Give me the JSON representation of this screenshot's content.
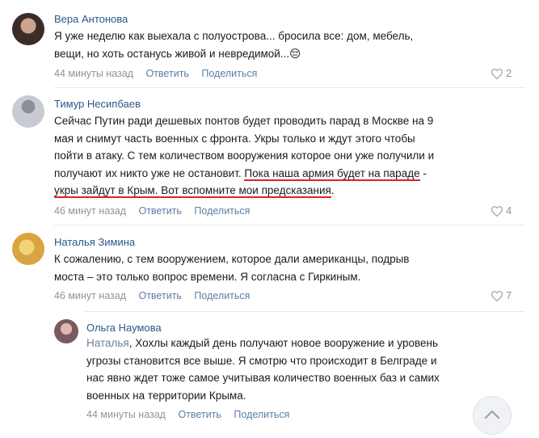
{
  "comments": [
    {
      "author": "Вера Антонова",
      "lines": [
        "Я уже неделю как выехала с полуострова... бросила все: дом, мебель,",
        "вещи, но хоть останусь живой и невредимой...😔"
      ],
      "time": "44 минуты назад",
      "reply": "Ответить",
      "share": "Поделиться",
      "likes": "2"
    },
    {
      "author": "Тимур Несипбаев",
      "lines": [
        "Сейчас Путин ради дешевых понтов будет проводить парад в Москве на 9",
        "мая и снимут часть военных с фронта. Укры только и ждут этого чтобы",
        "пойти в атаку. С тем количеством вооружения которое они уже получили и",
        "получают их никто уже не остановит. "
      ],
      "highlight1": "Пока наша армия будет на параде",
      "highlight1_tail": " -",
      "line5": "укры зайдут в Крым. Вот вспомните мои предсказания",
      "line5_tail": ".",
      "time": "46 минут назад",
      "reply": "Ответить",
      "share": "Поделиться",
      "likes": "4"
    },
    {
      "author": "Наталья Зимина",
      "lines": [
        "К сожалению, с тем вооружением, которое дали американцы, подрыв",
        "моста – это только вопрос времени. Я согласна с Гиркиным."
      ],
      "time": "46 минут назад",
      "reply": "Ответить",
      "share": "Поделиться",
      "likes": "7"
    },
    {
      "author": "Ольга Наумова",
      "reply_to": "Наталья",
      "first_line_rest": ", Хохлы каждый день получают новое вооружение и уровень",
      "lines": [
        "угрозы становится все выше. Я смотрю что происходит в Белграде и",
        "нас явно ждет тоже самое учитывая количество военных баз и самих",
        "военных на территории Крыма."
      ],
      "time": "44 минуты назад",
      "reply": "Ответить",
      "share": "Поделиться"
    }
  ],
  "colors": {
    "name": "#2a5885",
    "link": "#5b7fa6",
    "meta": "#939393",
    "underline": "#d22222"
  },
  "icons": {
    "like": "heart-icon",
    "scroll": "chevron-up-icon"
  }
}
